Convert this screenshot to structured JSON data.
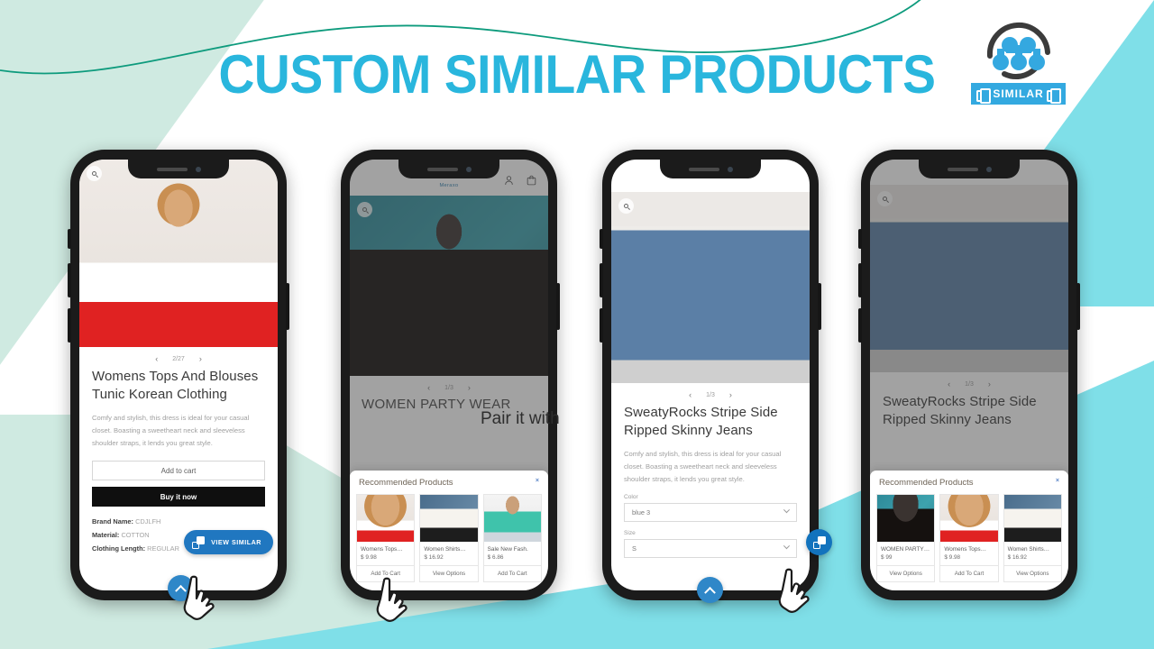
{
  "header": {
    "title": "CUSTOM SIMILAR PRODUCTS",
    "logo_badge": "SIMILAR",
    "brand_color": "#29b6dd"
  },
  "callout": {
    "pair_it_with": "Pair it with"
  },
  "phones": [
    {
      "id": "phone-1",
      "store_name": "",
      "pager": "2/27",
      "pager_prev": "‹",
      "pager_next": "›",
      "product_title": "Womens Tops And Blouses Tunic Korean Clothing",
      "product_desc": "Comfy and stylish, this dress is ideal for your casual closet. Boasting a sweetheart neck and sleeveless shoulder straps, it lends you great style.",
      "add_to_cart": "Add to cart",
      "buy_it_now": "Buy it now",
      "meta": [
        {
          "label": "Brand Name:",
          "value": "CDJLFH"
        },
        {
          "label": "Material:",
          "value": "COTTON"
        },
        {
          "label": "Clothing Length:",
          "value": "REGULAR"
        }
      ],
      "view_similar": "VIEW SIMILAR"
    },
    {
      "id": "phone-2",
      "store_name": "Meraxo",
      "pager": "1/3",
      "pager_prev": "‹",
      "pager_next": "›",
      "product_title": "WOMEN PARTY WEAR",
      "rec_title": "Recommended Products",
      "rec_close": "×",
      "rec_items": [
        {
          "name": "Womens Tops…",
          "price": "$ 9.98",
          "action": "Add To Cart",
          "art": "ph-model1"
        },
        {
          "name": "Women Shirts…",
          "price": "$ 16.92",
          "action": "View Options",
          "art": "ph-white"
        },
        {
          "name": "Sale New Fash.",
          "price": "$ 6.86",
          "action": "Add To Cart",
          "art": "ph-green"
        }
      ]
    },
    {
      "id": "phone-3",
      "pager": "1/3",
      "pager_prev": "‹",
      "pager_next": "›",
      "product_title": "SweatyRocks Stripe Side Ripped Skinny Jeans",
      "product_desc": "Comfy and stylish, this dress is ideal for your casual closet. Boasting a sweetheart neck and sleeveless shoulder straps, it lends you great style.",
      "color_label": "Color",
      "color_value": "blue 3",
      "size_label": "Size",
      "size_value": "S"
    },
    {
      "id": "phone-4",
      "pager": "1/3",
      "pager_prev": "‹",
      "pager_next": "›",
      "product_title": "SweatyRocks Stripe Side Ripped Skinny Jeans",
      "rec_title": "Recommended Products",
      "rec_close": "×",
      "rec_items": [
        {
          "name": "WOMEN PARTY…",
          "price": "$ 99",
          "action": "View Options",
          "art": "ph-model2"
        },
        {
          "name": "Womens Tops…",
          "price": "$ 9.98",
          "action": "Add To Cart",
          "art": "ph-model1"
        },
        {
          "name": "Women Shirts…",
          "price": "$ 16.92",
          "action": "View Options",
          "art": "ph-white"
        }
      ]
    }
  ]
}
